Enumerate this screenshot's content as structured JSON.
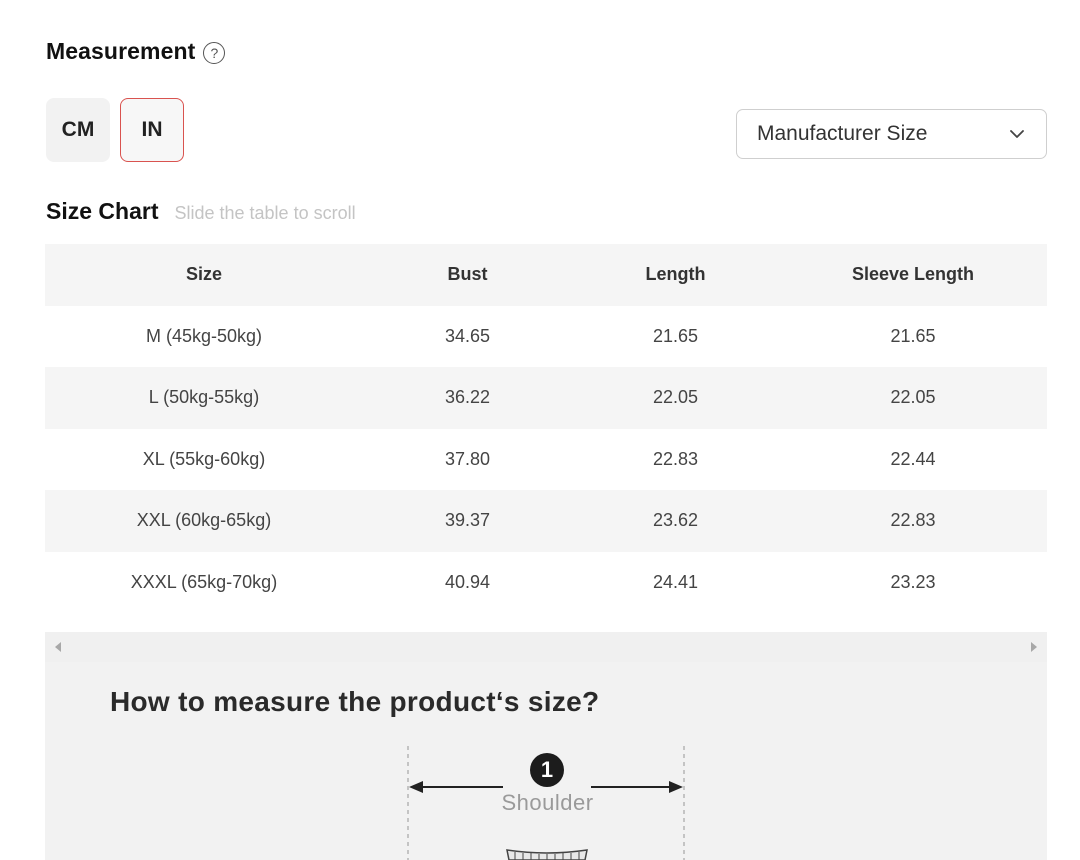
{
  "measurement": {
    "title": "Measurement",
    "help_glyph": "?"
  },
  "units": [
    {
      "label": "CM",
      "active": false
    },
    {
      "label": "IN",
      "active": true
    }
  ],
  "size_select": {
    "value": "Manufacturer Size"
  },
  "size_chart": {
    "title": "Size Chart",
    "hint": "Slide the table to scroll",
    "headers": [
      "Size",
      "Bust",
      "Length",
      "Sleeve Length"
    ],
    "rows": [
      [
        "M (45kg-50kg)",
        "34.65",
        "21.65",
        "21.65"
      ],
      [
        "L (50kg-55kg)",
        "36.22",
        "22.05",
        "22.05"
      ],
      [
        "XL (55kg-60kg)",
        "37.80",
        "22.83",
        "22.44"
      ],
      [
        "XXL (60kg-65kg)",
        "39.37",
        "23.62",
        "22.83"
      ],
      [
        "XXXL (65kg-70kg)",
        "40.94",
        "24.41",
        "23.23"
      ]
    ]
  },
  "guide": {
    "title": "How to measure the product‘s size?",
    "step_number": "1",
    "step_label": "Shoulder"
  },
  "colors": {
    "active_border": "#d9534f",
    "stripe": "#f5f5f5"
  }
}
